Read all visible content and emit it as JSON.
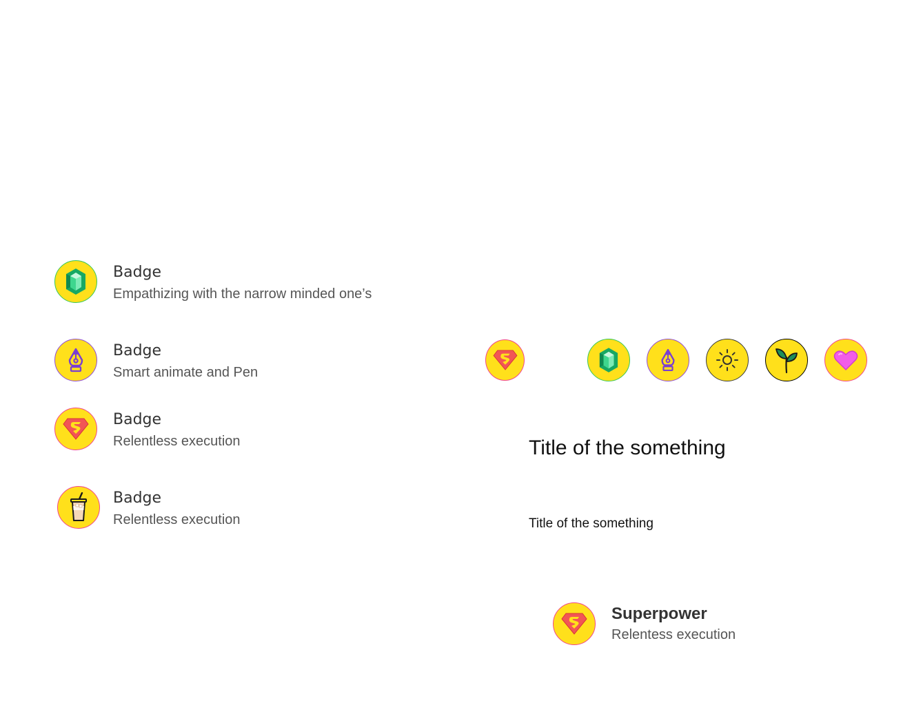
{
  "badge_list": [
    {
      "title": "Badge",
      "description": "Empathizing with the narrow minded one’s",
      "icon": "gem-icon"
    },
    {
      "title": "Badge",
      "description": "Smart animate and Pen",
      "icon": "pen-tool-icon"
    },
    {
      "title": "Badge",
      "description": "Relentless execution",
      "icon": "superman-icon"
    },
    {
      "title": "Badge",
      "description": "Relentless execution",
      "icon": "iced-coffee-icon"
    }
  ],
  "badge_row": {
    "icons": [
      "superman-icon",
      "gem-icon",
      "pen-tool-icon",
      "sun-icon",
      "sprout-icon",
      "heart-icon"
    ]
  },
  "headings": {
    "large": "Title of the something",
    "small": "Title of the something"
  },
  "superpower": {
    "title": "Superpower",
    "description": "Relentess execution",
    "icon": "superman-icon"
  },
  "colors": {
    "badge_fill": "#FFE01B",
    "green_ring": "#35C759",
    "purple_ring": "#8E4BD6",
    "pink_ring": "#F0468A",
    "heart": "#F25CE8"
  }
}
